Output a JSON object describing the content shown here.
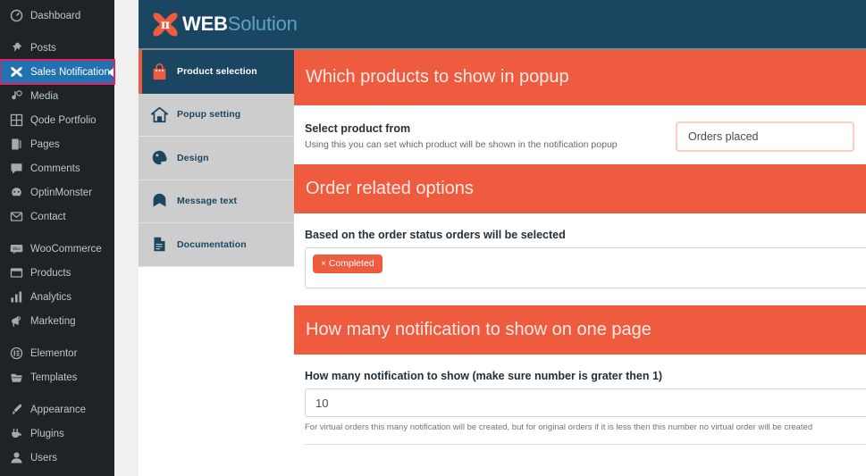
{
  "wp_sidebar": {
    "items": [
      {
        "label": "Dashboard",
        "icon": "dashboard-icon",
        "active": false,
        "gap_before": false
      },
      {
        "label": "Posts",
        "icon": "pin-icon",
        "active": false,
        "gap_before": true
      },
      {
        "label": "Sales Notification",
        "icon": "sales-notification-icon",
        "active": true,
        "gap_before": false
      },
      {
        "label": "Media",
        "icon": "media-icon",
        "active": false,
        "gap_before": false
      },
      {
        "label": "Qode Portfolio",
        "icon": "grid-icon",
        "active": false,
        "gap_before": false
      },
      {
        "label": "Pages",
        "icon": "pages-icon",
        "active": false,
        "gap_before": false
      },
      {
        "label": "Comments",
        "icon": "comments-icon",
        "active": false,
        "gap_before": false
      },
      {
        "label": "OptinMonster",
        "icon": "optinmonster-icon",
        "active": false,
        "gap_before": false
      },
      {
        "label": "Contact",
        "icon": "envelope-icon",
        "active": false,
        "gap_before": false
      },
      {
        "label": "WooCommerce",
        "icon": "woocommerce-icon",
        "active": false,
        "gap_before": true
      },
      {
        "label": "Products",
        "icon": "products-icon",
        "active": false,
        "gap_before": false
      },
      {
        "label": "Analytics",
        "icon": "analytics-icon",
        "active": false,
        "gap_before": false
      },
      {
        "label": "Marketing",
        "icon": "megaphone-icon",
        "active": false,
        "gap_before": false
      },
      {
        "label": "Elementor",
        "icon": "elementor-icon",
        "active": false,
        "gap_before": true
      },
      {
        "label": "Templates",
        "icon": "folder-icon",
        "active": false,
        "gap_before": false
      },
      {
        "label": "Appearance",
        "icon": "brush-icon",
        "active": false,
        "gap_before": true
      },
      {
        "label": "Plugins",
        "icon": "plug-icon",
        "active": false,
        "gap_before": false
      },
      {
        "label": "Users",
        "icon": "user-icon",
        "active": false,
        "gap_before": false
      }
    ]
  },
  "plugin": {
    "brand_primary": "WEB",
    "brand_secondary": "Solution",
    "colors": {
      "header_navy": "#1b4662",
      "accent_orange": "#ef5b3f",
      "tab_gray": "#cdcdcd",
      "wp_active_blue": "#2271b1",
      "wp_highlight_pink": "#e91e63",
      "select_border_pink": "#f6cec4"
    },
    "tabs": [
      {
        "label": "Product selection",
        "icon": "shopping-bag-icon",
        "active": true
      },
      {
        "label": "Popup setting",
        "icon": "home-icon",
        "active": false
      },
      {
        "label": "Design",
        "icon": "palette-icon",
        "active": false
      },
      {
        "label": "Message text",
        "icon": "message-icon",
        "active": false
      },
      {
        "label": "Documentation",
        "icon": "document-icon",
        "active": false
      }
    ],
    "sections": {
      "products": {
        "heading": "Which products to show in popup",
        "field_label": "Select product from",
        "field_desc": "Using this you can set which product will be shown in the notification popup",
        "select_value": "Orders placed"
      },
      "order_options": {
        "heading": "Order related options",
        "field_label": "Based on the order status orders will be selected",
        "tags": [
          {
            "remove": "×",
            "label": "Completed"
          }
        ]
      },
      "count": {
        "heading": "How many notification to show on one page",
        "field_label": "How many notification to show (make sure number is grater then 1)",
        "value": "10",
        "hint": "For virtual orders this many notification will be created, but for original orders if it is less then this number no virtual order will be created"
      }
    }
  }
}
